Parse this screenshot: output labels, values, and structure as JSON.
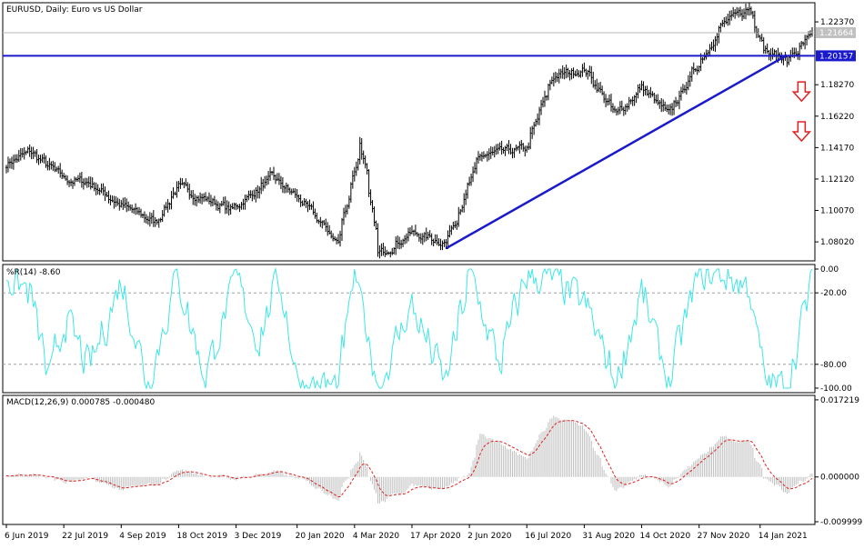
{
  "colors": {
    "background": "#ffffff",
    "bar": "#000000",
    "trendline": "#1a1acc",
    "wpr_line": "#3fe6e6",
    "macd_hist": "#c0c0c0",
    "macd_signal": "#e02020",
    "arrow": "#e02020",
    "current_price_box": "#c0c0c0",
    "level_box": "#1a1acc"
  },
  "chart_data": [
    {
      "type": "bar",
      "subtype": "ohlc",
      "title": "EURUSD, Daily:  Euro vs US Dollar",
      "y_ticks": [
        "1.22370",
        "1.20157",
        "1.18270",
        "1.16220",
        "1.14170",
        "1.12120",
        "1.10070",
        "1.08020"
      ],
      "ylim": [
        1.069,
        1.235
      ],
      "current_price": "1.21664",
      "horizontal_level": "1.20157",
      "x_ticks": [
        "6 Jun 2019",
        "22 Jul 2019",
        "4 Sep 2019",
        "18 Oct 2019",
        "3 Dec 2019",
        "20 Jan 2020",
        "4 Mar 2020",
        "17 Apr 2020",
        "2 Jun 2020",
        "16 Jul 2020",
        "31 Aug 2020",
        "14 Oct 2020",
        "27 Nov 2020",
        "14 Jan 2021"
      ],
      "x_dates": [
        "2019-06-06",
        "2019-07-22",
        "2019-09-04",
        "2019-10-18",
        "2019-12-03",
        "2020-01-20",
        "2020-03-04",
        "2020-04-17",
        "2020-06-02",
        "2020-07-16",
        "2020-08-31",
        "2020-10-14",
        "2020-11-27",
        "2021-01-14"
      ],
      "close_anchors": [
        {
          "date": "2019-06-06",
          "value": 1.131
        },
        {
          "date": "2019-06-25",
          "value": 1.139
        },
        {
          "date": "2019-07-22",
          "value": 1.121
        },
        {
          "date": "2019-08-10",
          "value": 1.119
        },
        {
          "date": "2019-09-04",
          "value": 1.104
        },
        {
          "date": "2019-10-01",
          "value": 1.093
        },
        {
          "date": "2019-10-18",
          "value": 1.116
        },
        {
          "date": "2019-11-29",
          "value": 1.101
        },
        {
          "date": "2019-12-31",
          "value": 1.122
        },
        {
          "date": "2020-01-20",
          "value": 1.109
        },
        {
          "date": "2020-02-20",
          "value": 1.08
        },
        {
          "date": "2020-03-09",
          "value": 1.145
        },
        {
          "date": "2020-03-23",
          "value": 1.072
        },
        {
          "date": "2020-04-17",
          "value": 1.086
        },
        {
          "date": "2020-05-14",
          "value": 1.08
        },
        {
          "date": "2020-06-02",
          "value": 1.118
        },
        {
          "date": "2020-06-10",
          "value": 1.136
        },
        {
          "date": "2020-07-16",
          "value": 1.141
        },
        {
          "date": "2020-08-06",
          "value": 1.188
        },
        {
          "date": "2020-08-31",
          "value": 1.193
        },
        {
          "date": "2020-09-24",
          "value": 1.163
        },
        {
          "date": "2020-10-14",
          "value": 1.181
        },
        {
          "date": "2020-11-04",
          "value": 1.163
        },
        {
          "date": "2020-11-27",
          "value": 1.196
        },
        {
          "date": "2020-12-16",
          "value": 1.222
        },
        {
          "date": "2021-01-06",
          "value": 1.232
        },
        {
          "date": "2021-01-18",
          "value": 1.208
        },
        {
          "date": "2021-02-04",
          "value": 1.198
        },
        {
          "date": "2021-02-24",
          "value": 1.2166
        }
      ],
      "trendline": [
        {
          "date": "2020-05-14",
          "value": 1.076
        },
        {
          "date": "2021-02-04",
          "value": 1.202
        }
      ],
      "arrows": [
        {
          "date": "2021-02-05",
          "value": 1.178,
          "direction": "down"
        },
        {
          "date": "2021-02-05",
          "value": 1.152,
          "direction": "down"
        }
      ],
      "grid": false
    },
    {
      "type": "line",
      "title": "%R(14) -8.60",
      "y_ticks": [
        "0.00",
        "-20.00",
        "-80.00",
        "-100.00"
      ],
      "ylim": [
        -100,
        0
      ],
      "levels": [
        -20,
        -80
      ],
      "swing_anchors": [
        {
          "date": "2019-06-06",
          "value": -5
        },
        {
          "date": "2019-06-25",
          "value": -20
        },
        {
          "date": "2019-07-10",
          "value": -95
        },
        {
          "date": "2019-07-22",
          "value": -40
        },
        {
          "date": "2019-08-10",
          "value": -85
        },
        {
          "date": "2019-09-04",
          "value": -10
        },
        {
          "date": "2019-09-25",
          "value": -95
        },
        {
          "date": "2019-10-18",
          "value": -5
        },
        {
          "date": "2019-11-08",
          "value": -90
        },
        {
          "date": "2019-12-03",
          "value": -10
        },
        {
          "date": "2019-12-20",
          "value": -60
        },
        {
          "date": "2020-01-05",
          "value": -5
        },
        {
          "date": "2020-01-20",
          "value": -95
        },
        {
          "date": "2020-02-20",
          "value": -100
        },
        {
          "date": "2020-03-04",
          "value": -5
        },
        {
          "date": "2020-03-23",
          "value": -100
        },
        {
          "date": "2020-04-17",
          "value": -30
        },
        {
          "date": "2020-05-14",
          "value": -95
        },
        {
          "date": "2020-06-02",
          "value": -5
        },
        {
          "date": "2020-06-25",
          "value": -80
        },
        {
          "date": "2020-07-16",
          "value": -5
        },
        {
          "date": "2020-08-06",
          "value": -10
        },
        {
          "date": "2020-08-31",
          "value": -30
        },
        {
          "date": "2020-09-24",
          "value": -95
        },
        {
          "date": "2020-10-14",
          "value": -20
        },
        {
          "date": "2020-11-04",
          "value": -95
        },
        {
          "date": "2020-11-27",
          "value": -5
        },
        {
          "date": "2020-12-16",
          "value": -5
        },
        {
          "date": "2021-01-06",
          "value": -15
        },
        {
          "date": "2021-01-18",
          "value": -95
        },
        {
          "date": "2021-02-04",
          "value": -100
        },
        {
          "date": "2021-02-24",
          "value": -8.6
        }
      ]
    },
    {
      "type": "bar",
      "title": "MACD(12,26,9) 0.000785 -0.000480",
      "y_ticks": [
        "0.017219",
        "0.000000",
        "-0.009999"
      ],
      "ylim": [
        -0.01,
        0.0172
      ],
      "macd_anchors": [
        {
          "date": "2019-06-06",
          "value": 0.0003
        },
        {
          "date": "2019-06-25",
          "value": 0.001
        },
        {
          "date": "2019-07-22",
          "value": -0.0012
        },
        {
          "date": "2019-08-10",
          "value": -0.0006
        },
        {
          "date": "2019-09-04",
          "value": -0.0028
        },
        {
          "date": "2019-10-01",
          "value": -0.0018
        },
        {
          "date": "2019-10-18",
          "value": 0.0016
        },
        {
          "date": "2019-11-29",
          "value": -0.0005
        },
        {
          "date": "2019-12-31",
          "value": 0.0012
        },
        {
          "date": "2020-01-20",
          "value": -0.0004
        },
        {
          "date": "2020-02-20",
          "value": -0.0045
        },
        {
          "date": "2020-03-09",
          "value": 0.006
        },
        {
          "date": "2020-03-23",
          "value": -0.006
        },
        {
          "date": "2020-04-17",
          "value": -0.002
        },
        {
          "date": "2020-05-14",
          "value": -0.0022
        },
        {
          "date": "2020-06-02",
          "value": 0.001
        },
        {
          "date": "2020-06-10",
          "value": 0.0098
        },
        {
          "date": "2020-07-16",
          "value": 0.0038
        },
        {
          "date": "2020-08-06",
          "value": 0.014
        },
        {
          "date": "2020-08-31",
          "value": 0.0105
        },
        {
          "date": "2020-09-24",
          "value": -0.003
        },
        {
          "date": "2020-10-14",
          "value": 0.0006
        },
        {
          "date": "2020-11-04",
          "value": -0.0015
        },
        {
          "date": "2020-11-27",
          "value": 0.004
        },
        {
          "date": "2020-12-16",
          "value": 0.009
        },
        {
          "date": "2021-01-06",
          "value": 0.008
        },
        {
          "date": "2021-01-18",
          "value": -0.0005
        },
        {
          "date": "2021-02-04",
          "value": -0.0032
        },
        {
          "date": "2021-02-24",
          "value": 0.0008
        }
      ]
    }
  ]
}
